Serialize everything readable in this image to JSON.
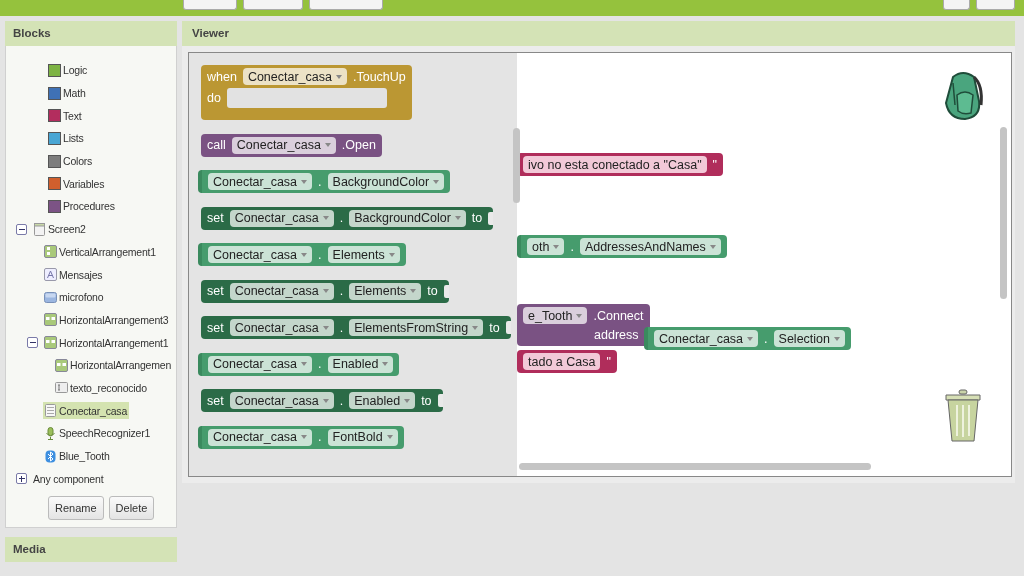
{
  "blocks_panel": {
    "title": "Blocks",
    "builtin": [
      {
        "label": "Logic",
        "color": "#7db343"
      },
      {
        "label": "Math",
        "color": "#3f71b5"
      },
      {
        "label": "Text",
        "color": "#b32d5e"
      },
      {
        "label": "Lists",
        "color": "#49a6d4"
      },
      {
        "label": "Colors",
        "color": "#7d7d7d"
      },
      {
        "label": "Variables",
        "color": "#d05f2d"
      },
      {
        "label": "Procedures",
        "color": "#7c5385"
      }
    ],
    "components": [
      {
        "label": "Screen2",
        "kind": "screen",
        "selected": false,
        "expanded": true,
        "children": [
          {
            "label": "VerticalArrangement1",
            "kind": "vertical",
            "selected": false
          },
          {
            "label": "Mensajes",
            "kind": "label",
            "selected": false
          },
          {
            "label": "microfono",
            "kind": "button",
            "selected": false
          },
          {
            "label": "HorizontalArrangement3",
            "kind": "horizontal",
            "selected": false
          },
          {
            "label": "HorizontalArrangement1",
            "kind": "horizontal",
            "selected": false,
            "expanded": true,
            "children": [
              {
                "label": "HorizontalArrangemen",
                "kind": "horizontal",
                "selected": false
              },
              {
                "label": "texto_reconocido",
                "kind": "textbox",
                "selected": false
              }
            ]
          },
          {
            "label": "Conectar_casa",
            "kind": "listpicker",
            "selected": true
          },
          {
            "label": "SpeechRecognizer1",
            "kind": "speech",
            "selected": false
          },
          {
            "label": "Blue_Tooth",
            "kind": "bluetooth",
            "selected": false
          }
        ]
      }
    ],
    "any_component": {
      "label": "Any component",
      "expanded": false
    },
    "buttons": [
      "Rename",
      "Delete"
    ]
  },
  "media_panel": {
    "title": "Media"
  },
  "viewer": {
    "title": "Viewer",
    "flyout": [
      {
        "kind": "event",
        "parts": [
          {
            "kind": "label",
            "text": "when"
          },
          {
            "kind": "dropdown",
            "text": "Conectar_casa"
          },
          {
            "kind": "label",
            "text": ".TouchUp"
          }
        ],
        "do_label": "do"
      },
      {
        "kind": "call",
        "parts": [
          {
            "kind": "label",
            "text": "call"
          },
          {
            "kind": "dropdown",
            "text": "Conectar_casa"
          },
          {
            "kind": "label",
            "text": ".Open"
          }
        ]
      },
      {
        "kind": "getter",
        "parts": [
          {
            "kind": "dropdown",
            "text": "Conectar_casa"
          },
          {
            "kind": "label",
            "text": "."
          },
          {
            "kind": "dropdown",
            "text": "BackgroundColor"
          }
        ]
      },
      {
        "kind": "setter",
        "parts": [
          {
            "kind": "label",
            "text": "set"
          },
          {
            "kind": "dropdown",
            "text": "Conectar_casa"
          },
          {
            "kind": "label",
            "text": "."
          },
          {
            "kind": "dropdown",
            "text": "BackgroundColor"
          },
          {
            "kind": "label",
            "text": "to"
          },
          {
            "kind": "socket"
          }
        ]
      },
      {
        "kind": "getter",
        "parts": [
          {
            "kind": "dropdown",
            "text": "Conectar_casa"
          },
          {
            "kind": "label",
            "text": "."
          },
          {
            "kind": "dropdown",
            "text": "Elements"
          }
        ]
      },
      {
        "kind": "setter",
        "parts": [
          {
            "kind": "label",
            "text": "set"
          },
          {
            "kind": "dropdown",
            "text": "Conectar_casa"
          },
          {
            "kind": "label",
            "text": "."
          },
          {
            "kind": "dropdown",
            "text": "Elements"
          },
          {
            "kind": "label",
            "text": "to"
          },
          {
            "kind": "socket"
          }
        ]
      },
      {
        "kind": "setter",
        "parts": [
          {
            "kind": "label",
            "text": "set"
          },
          {
            "kind": "dropdown",
            "text": "Conectar_casa"
          },
          {
            "kind": "label",
            "text": "."
          },
          {
            "kind": "dropdown",
            "text": "ElementsFromString"
          },
          {
            "kind": "label",
            "text": "to"
          },
          {
            "kind": "socket"
          }
        ]
      },
      {
        "kind": "getter",
        "parts": [
          {
            "kind": "dropdown",
            "text": "Conectar_casa"
          },
          {
            "kind": "label",
            "text": "."
          },
          {
            "kind": "dropdown",
            "text": "Enabled"
          }
        ]
      },
      {
        "kind": "setter",
        "parts": [
          {
            "kind": "label",
            "text": "set"
          },
          {
            "kind": "dropdown",
            "text": "Conectar_casa"
          },
          {
            "kind": "label",
            "text": "."
          },
          {
            "kind": "dropdown",
            "text": "Enabled"
          },
          {
            "kind": "label",
            "text": "to"
          },
          {
            "kind": "socket"
          }
        ]
      },
      {
        "kind": "getter",
        "parts": [
          {
            "kind": "dropdown",
            "text": "Conectar_casa"
          },
          {
            "kind": "label",
            "text": "."
          },
          {
            "kind": "dropdown",
            "text": "FontBold"
          }
        ]
      }
    ],
    "workspace": [
      {
        "kind": "text",
        "parts": [
          {
            "kind": "string",
            "text": "ivo no esta conectado a \"Casa\""
          },
          {
            "kind": "label",
            "text": "\""
          }
        ]
      },
      {
        "kind": "getter",
        "parts": [
          {
            "kind": "dropdown",
            "text": "oth"
          },
          {
            "kind": "label",
            "text": "."
          },
          {
            "kind": "dropdown",
            "text": "AddressesAndNames"
          }
        ]
      },
      {
        "kind": "call",
        "parts": [
          {
            "kind": "dropdown",
            "text": "e_Tooth"
          },
          {
            "kind": "label",
            "text": ".Connect"
          }
        ],
        "args": [
          {
            "label": "address"
          }
        ]
      },
      {
        "kind": "getter",
        "parts": [
          {
            "kind": "dropdown",
            "text": "Conectar_casa"
          },
          {
            "kind": "label",
            "text": "."
          },
          {
            "kind": "dropdown",
            "text": "Selection"
          }
        ]
      },
      {
        "kind": "text",
        "parts": [
          {
            "kind": "string",
            "text": "tado a Casa"
          },
          {
            "kind": "label",
            "text": "\""
          }
        ]
      }
    ]
  }
}
